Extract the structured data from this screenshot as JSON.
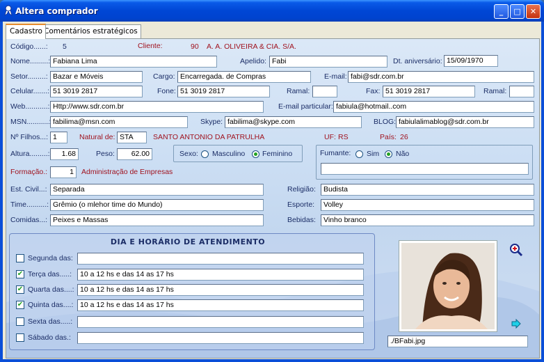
{
  "window": {
    "title": "Altera comprador",
    "minimize": "_",
    "maximize": "□",
    "close": "✕"
  },
  "tabs": [
    {
      "label": "Cadastro"
    },
    {
      "label": "Comentários estratégicos"
    }
  ],
  "fields": {
    "codigo_label": "Código......:",
    "codigo_value": "5",
    "cliente_label": "Cliente:",
    "cliente_code": "90",
    "cliente_name": "A. A. OLIVEIRA & CIA. S/A.",
    "nome_label": "Nome.........:",
    "nome_value": "Fabiana Lima",
    "apelido_label": "Apelido:",
    "apelido_value": "Fabi",
    "aniversario_label": "Dt. aniversário:",
    "aniversario_value": "15/09/1970",
    "setor_label": "Setor.........:",
    "setor_value": "Bazar e Móveis",
    "cargo_label": "Cargo:",
    "cargo_value": "Encarregada. de Compras",
    "email_label": "E-mail:",
    "email_value": "fabi@sdr.com.br",
    "celular_label": "Celular.......:",
    "celular_value": "51 3019 2817",
    "fone_label": "Fone:",
    "fone_value": "51 3019 2817",
    "ramal_label": "Ramal:",
    "ramal_value": "",
    "fax_label": "Fax:",
    "fax_value": "51 3019 2817",
    "ramal2_label": "Ramal:",
    "ramal2_value": "",
    "web_label": "Web...........:",
    "web_value": "Http://www.sdr.com.br",
    "email_part_label": "E-mail particular:",
    "email_part_value": "fabiula@hotmail..com",
    "msn_label": "MSN...........:",
    "msn_value": "fabilima@msn.com",
    "skype_label": "Skype:",
    "skype_value": "fabilima@skype.com",
    "blog_label": "BLOG:",
    "blog_value": "fabiulalimablog@sdr.com.br",
    "filhos_label": "Nº Filhos...:",
    "filhos_value": "1",
    "natural_label": "Natural de:",
    "natural_code": "STA",
    "natural_city": "SANTO ANTONIO DA PATRULHA",
    "uf_label": "UF:",
    "uf_value": "RS",
    "pais_label": "País:",
    "pais_value": "26",
    "altura_label": "Altura.........:",
    "altura_value": "1.68",
    "peso_label": "Peso:",
    "peso_value": "62.00",
    "sexo_label": "Sexo:",
    "sexo_masc": "Masculino",
    "sexo_fem": "Feminino",
    "fumante_label": "Fumante:",
    "fumante_sim": "Sim",
    "fumante_nao": "Não",
    "fumante_value": "",
    "formacao_label": "Formação.:",
    "formacao_code": "1",
    "formacao_text": "Administração de Empresas",
    "civil_label": "Est. Civil...:",
    "civil_value": "Separada",
    "religiao_label": "Religião:",
    "religiao_value": "Budista",
    "time_label": "Time..........:",
    "time_value": "Grêmio (o mlehor time do Mundo)",
    "esporte_label": "Esporte:",
    "esporte_value": "Volley",
    "comidas_label": "Comidas...:",
    "comidas_value": "Peixes e Massas",
    "bebidas_label": "Bebidas:",
    "bebidas_value": "Vinho branco"
  },
  "schedule": {
    "title": "DIA E HORÁRIO DE ATENDIMENTO",
    "days": [
      {
        "label": "Segunda das:",
        "checked": false,
        "hours": ""
      },
      {
        "label": "Terça das.....:",
        "checked": true,
        "hours": "10 a 12 hs e das 14 as 17 hs"
      },
      {
        "label": "Quarta das....:",
        "checked": true,
        "hours": "10 a 12  hs e das 14 as 17 hs"
      },
      {
        "label": "Quinta das....:",
        "checked": true,
        "hours": "10 a 12 hs e das 14 as 17 hs"
      },
      {
        "label": "Sexta das.....:",
        "checked": false,
        "hours": ""
      },
      {
        "label": "Sábado das.:",
        "checked": false,
        "hours": ""
      }
    ]
  },
  "photo": {
    "path": "./BFabi.jpg"
  },
  "icons": {
    "zoom": "zoom-in-icon",
    "next": "arrow-right-icon",
    "app": "ribbon-icon"
  },
  "colors": {
    "title_bar": "#0046d5",
    "value_red": "#a0121e",
    "label_blue": "#1b2d66",
    "check_green": "#21a121"
  }
}
